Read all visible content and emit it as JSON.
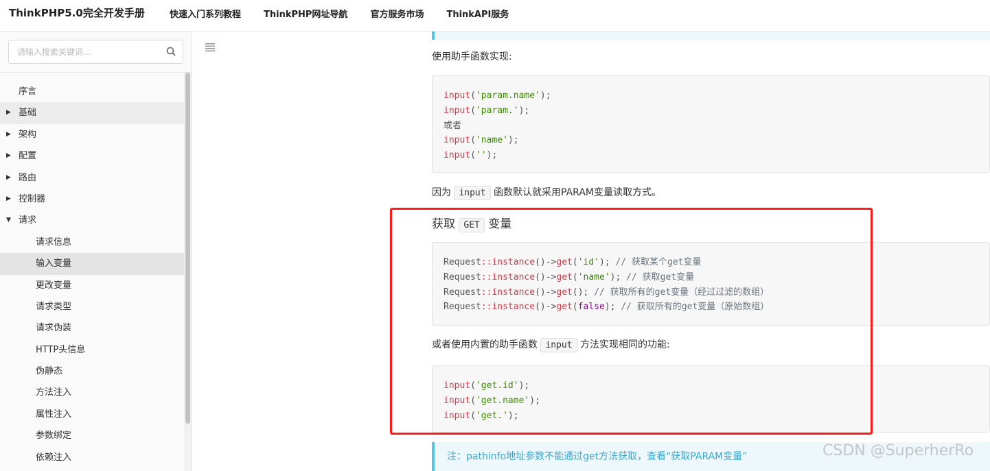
{
  "header": {
    "brand": "ThinkPHP5.0完全开发手册",
    "nav": [
      "快速入门系列教程",
      "ThinkPHP网址导航",
      "官方服务市场",
      "ThinkAPI服务"
    ]
  },
  "sidebar": {
    "search_placeholder": "请输入搜索关键词...",
    "items": [
      {
        "label": "序言",
        "level": 1,
        "caret": ""
      },
      {
        "label": "基础",
        "level": 1,
        "caret": "▶"
      },
      {
        "label": "架构",
        "level": 1,
        "caret": "▶"
      },
      {
        "label": "配置",
        "level": 1,
        "caret": "▶"
      },
      {
        "label": "路由",
        "level": 1,
        "caret": "▶"
      },
      {
        "label": "控制器",
        "level": 1,
        "caret": "▶"
      },
      {
        "label": "请求",
        "level": 1,
        "caret": "▼"
      },
      {
        "label": "请求信息",
        "level": 2,
        "caret": ""
      },
      {
        "label": "输入变量",
        "level": 2,
        "caret": ""
      },
      {
        "label": "更改变量",
        "level": 2,
        "caret": ""
      },
      {
        "label": "请求类型",
        "level": 2,
        "caret": ""
      },
      {
        "label": "请求伪装",
        "level": 2,
        "caret": ""
      },
      {
        "label": "HTTP头信息",
        "level": 2,
        "caret": ""
      },
      {
        "label": "伪静态",
        "level": 2,
        "caret": ""
      },
      {
        "label": "方法注入",
        "level": 2,
        "caret": ""
      },
      {
        "label": "属性注入",
        "level": 2,
        "caret": ""
      },
      {
        "label": "参数绑定",
        "level": 2,
        "caret": ""
      },
      {
        "label": "依赖注入",
        "level": 2,
        "caret": ""
      }
    ]
  },
  "content": {
    "p1": "使用助手函数实现:",
    "code1": {
      "l1_fn": "input",
      "l1_arg": "'param.name'",
      "l2_fn": "input",
      "l2_arg": "'param.'",
      "l3": "或者",
      "l4_fn": "input",
      "l4_arg": "'name'",
      "l5_fn": "input",
      "l5_arg": "''"
    },
    "p2_before": "因为",
    "p2_code": "input",
    "p2_after": "函数默认就采用PARAM变量读取方式。",
    "heading_before": "获取",
    "heading_code": "GET",
    "heading_after": "变量",
    "code2": {
      "cls": "Request",
      "sep": "::",
      "inst": "instance",
      "get": "get",
      "l1_arg": "'id'",
      "l1_cm": "// 获取某个get变量",
      "l2_arg": "'name'",
      "l2_cm": "// 获取get变量",
      "l3_cm": "// 获取所有的get变量（经过过滤的数组）",
      "l4_arg": "false",
      "l4_cm": "// 获取所有的get变量（原始数组）"
    },
    "p3_before": "或者使用内置的助手函数",
    "p3_code": "input",
    "p3_after": "方法实现相同的功能:",
    "code3": {
      "fn": "input",
      "l1_arg": "'get.id'",
      "l2_arg": "'get.name'",
      "l3_arg": "'get.'"
    },
    "note": "注：pathinfo地址参数不能通过get方法获取，查看“获取PARAM变量”"
  },
  "watermark": "CSDN @SuperherRo",
  "colors": {
    "highlight": "#ff1a1a",
    "note_accent": "#52c4e6",
    "keyword": "#d73a49",
    "string": "#3c8a00"
  }
}
